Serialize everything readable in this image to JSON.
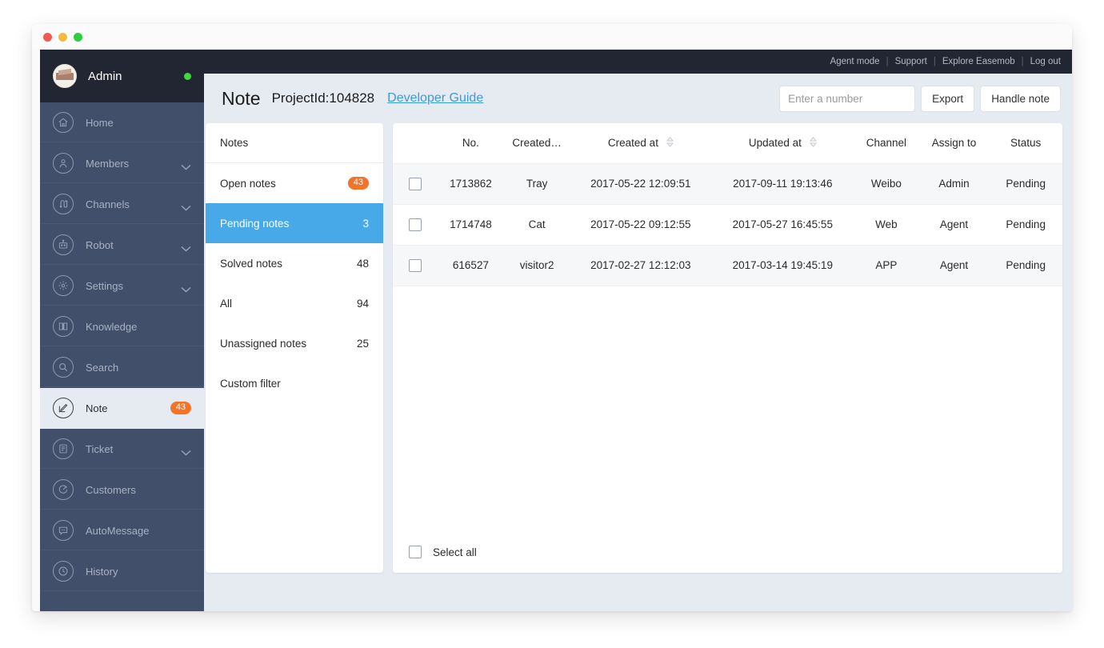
{
  "window": {
    "traffic_lights": [
      "close",
      "minimize",
      "maximize"
    ]
  },
  "sidebar": {
    "user": {
      "name": "Admin",
      "status": "online",
      "avatar": "user-avatar"
    },
    "items": [
      {
        "label": "Home",
        "icon": "home-icon",
        "expandable": false,
        "badge": null,
        "active": false
      },
      {
        "label": "Members",
        "icon": "members-icon",
        "expandable": true,
        "badge": null,
        "active": false
      },
      {
        "label": "Channels",
        "icon": "channels-icon",
        "expandable": true,
        "badge": null,
        "active": false
      },
      {
        "label": "Robot",
        "icon": "robot-icon",
        "expandable": true,
        "badge": null,
        "active": false
      },
      {
        "label": "Settings",
        "icon": "settings-icon",
        "expandable": true,
        "badge": null,
        "active": false
      },
      {
        "label": "Knowledge",
        "icon": "knowledge-icon",
        "expandable": false,
        "badge": null,
        "active": false
      },
      {
        "label": "Search",
        "icon": "search-icon",
        "expandable": false,
        "badge": null,
        "active": false
      },
      {
        "label": "Note",
        "icon": "note-icon",
        "expandable": false,
        "badge": "43",
        "active": true
      },
      {
        "label": "Ticket",
        "icon": "ticket-icon",
        "expandable": true,
        "badge": null,
        "active": false
      },
      {
        "label": "Customers",
        "icon": "customers-icon",
        "expandable": false,
        "badge": null,
        "active": false
      },
      {
        "label": "AutoMessage",
        "icon": "automessage-icon",
        "expandable": false,
        "badge": null,
        "active": false
      },
      {
        "label": "History",
        "icon": "history-icon",
        "expandable": false,
        "badge": null,
        "active": false
      }
    ]
  },
  "topbar": {
    "links": [
      "Agent mode",
      "Support",
      "Explore Easemob",
      "Log out"
    ],
    "separator": "|"
  },
  "page_header": {
    "title": "Note",
    "project_id": "ProjectId:104828",
    "developer_guide": "Developer Guide",
    "search_placeholder": "Enter a number",
    "search_value": "",
    "export_label": "Export",
    "handle_note_label": "Handle note"
  },
  "filters": {
    "header": "Notes",
    "items": [
      {
        "label": "Open notes",
        "count": "43",
        "badge": true,
        "selected": false
      },
      {
        "label": "Pending notes",
        "count": "3",
        "badge": false,
        "selected": true
      },
      {
        "label": "Solved notes",
        "count": "48",
        "badge": false,
        "selected": false
      },
      {
        "label": "All",
        "count": "94",
        "badge": false,
        "selected": false
      },
      {
        "label": "Unassigned notes",
        "count": "25",
        "badge": false,
        "selected": false
      },
      {
        "label": "Custom filter",
        "count": "",
        "badge": false,
        "selected": false
      }
    ]
  },
  "table": {
    "columns": [
      {
        "key": "checkbox",
        "label": "",
        "sortable": false
      },
      {
        "key": "no",
        "label": "No.",
        "sortable": false
      },
      {
        "key": "created_by",
        "label": "Created…",
        "sortable": false
      },
      {
        "key": "created_at",
        "label": "Created at",
        "sortable": true
      },
      {
        "key": "updated_at",
        "label": "Updated at",
        "sortable": true
      },
      {
        "key": "channel",
        "label": "Channel",
        "sortable": false
      },
      {
        "key": "assign_to",
        "label": "Assign to",
        "sortable": false
      },
      {
        "key": "status",
        "label": "Status",
        "sortable": false
      }
    ],
    "rows": [
      {
        "checked": false,
        "no": "1713862",
        "created_by": "Tray",
        "created_at": "2017-05-22 12:09:51",
        "updated_at": "2017-09-11 19:13:46",
        "channel": "Weibo",
        "assign_to": "Admin",
        "status": "Pending"
      },
      {
        "checked": false,
        "no": "1714748",
        "created_by": "Cat",
        "created_at": "2017-05-22 09:12:55",
        "updated_at": "2017-05-27 16:45:55",
        "channel": "Web",
        "assign_to": "Agent",
        "status": "Pending"
      },
      {
        "checked": false,
        "no": "616527",
        "created_by": "visitor2",
        "created_at": "2017-02-27 12:12:03",
        "updated_at": "2017-03-14 19:45:19",
        "channel": "APP",
        "assign_to": "Agent",
        "status": "Pending"
      }
    ],
    "select_all_label": "Select all",
    "select_all_checked": false
  },
  "colors": {
    "sidebar_bg": "#414f6b",
    "sidebar_dark": "#222633",
    "accent_blue": "#47a9e8",
    "badge_orange": "#f2742b",
    "link_blue": "#3b9ae1",
    "content_bg": "#e6eaf1",
    "status_online": "#3ddb3d"
  }
}
